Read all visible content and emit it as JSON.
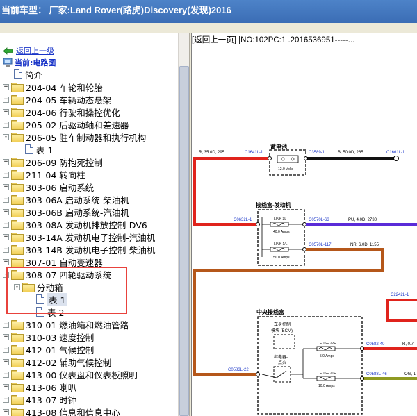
{
  "window": {
    "title": "当前车型： 厂家:Land Rover(路虎)Discovery(发现)2016"
  },
  "tree": {
    "back_label": "返回上一级",
    "current_label": "当前:电路图",
    "items": [
      {
        "label": "简介",
        "type": "doc",
        "indent": 1,
        "expand": ""
      },
      {
        "label": "204-04 车轮和轮胎",
        "type": "folder",
        "indent": 0,
        "expand": "+"
      },
      {
        "label": "204-05 车辆动态悬架",
        "type": "folder",
        "indent": 0,
        "expand": "+"
      },
      {
        "label": "204-06 行驶和操控优化",
        "type": "folder",
        "indent": 0,
        "expand": "+"
      },
      {
        "label": "205-02 后驱动轴和差速器",
        "type": "folder",
        "indent": 0,
        "expand": "+"
      },
      {
        "label": "206-05 驻车制动器和执行机构",
        "type": "folder",
        "indent": 0,
        "expand": "-"
      },
      {
        "label": "表 1",
        "type": "doc",
        "indent": 2,
        "expand": ""
      },
      {
        "label": "206-09 防抱死控制",
        "type": "folder",
        "indent": 0,
        "expand": "+"
      },
      {
        "label": "211-04 转向柱",
        "type": "folder",
        "indent": 0,
        "expand": "+"
      },
      {
        "label": "303-06 启动系统",
        "type": "folder",
        "indent": 0,
        "expand": "+"
      },
      {
        "label": "303-06A 启动系统-柴油机",
        "type": "folder",
        "indent": 0,
        "expand": "+"
      },
      {
        "label": "303-06B 启动系统-汽油机",
        "type": "folder",
        "indent": 0,
        "expand": "+"
      },
      {
        "label": "303-08A 发动机排放控制-DV6",
        "type": "folder",
        "indent": 0,
        "expand": "+"
      },
      {
        "label": "303-14A 发动机电子控制-汽油机",
        "type": "folder",
        "indent": 0,
        "expand": "+"
      },
      {
        "label": "303-14B 发动机电子控制-柴油机",
        "type": "folder",
        "indent": 0,
        "expand": "+"
      },
      {
        "label": "307-01 自动变速器",
        "type": "folder",
        "indent": 0,
        "expand": "+"
      },
      {
        "label": "308-07 四轮驱动系统",
        "type": "folder",
        "indent": 0,
        "expand": "-"
      },
      {
        "label": "分动箱",
        "type": "folder",
        "indent": 1,
        "expand": "-"
      },
      {
        "label": "表 1",
        "type": "doc",
        "indent": 3,
        "expand": "",
        "selected": true
      },
      {
        "label": "表 2",
        "type": "doc",
        "indent": 3,
        "expand": ""
      },
      {
        "label": "310-01 燃油箱和燃油管路",
        "type": "folder",
        "indent": 0,
        "expand": "+"
      },
      {
        "label": "310-03 速度控制",
        "type": "folder",
        "indent": 0,
        "expand": "+"
      },
      {
        "label": "412-01 气候控制",
        "type": "folder",
        "indent": 0,
        "expand": "+"
      },
      {
        "label": "412-02 辅助气候控制",
        "type": "folder",
        "indent": 0,
        "expand": "+"
      },
      {
        "label": "413-00 仪表盘和仪表板照明",
        "type": "folder",
        "indent": 0,
        "expand": "+"
      },
      {
        "label": "413-06 喇叭",
        "type": "folder",
        "indent": 0,
        "expand": "+"
      },
      {
        "label": "413-07 时钟",
        "type": "folder",
        "indent": 0,
        "expand": "+"
      },
      {
        "label": "413-08 信息和信息中心",
        "type": "folder",
        "indent": 0,
        "expand": "+"
      }
    ]
  },
  "content": {
    "nav_text": "[返回上一页] |NO:102PC:1 .2016536951-----...",
    "diagram": {
      "battery_title": "蓄电池",
      "battery_rating": "12.0 Volts",
      "wire_left_top": "R, 35.0D, 295",
      "conn_c1641l1a": "C1641L-1",
      "conn_c3589": "C3589-1",
      "wire_black": "B, 50.0D, 265",
      "conn_c1661l1": "C1661L-1",
      "fusebox_title": "接线盒-发动机",
      "conn_c0632l1": "C0632L-1",
      "link_3l": "LINK 3L",
      "amps_40": "40.0 Amps",
      "conn_c0570l63": "C0570L-63",
      "wire_pu": "PU, 4.0D, 2730",
      "link_1l": "LINK 1/L",
      "amps_50": "50.0 Amps",
      "conn_c0570l117": "C0570L-117",
      "wire_nr": "NR, 6.0D, 1155",
      "conn_c2242l1": "C2242L-1",
      "central_title": "中央接线盒",
      "bcm_line1": "车身控制",
      "bcm_line2": "模块 (BCM)",
      "relay_line1": "继电器-",
      "relay_line2": "点火",
      "fuse_22": "FUSE 22F",
      "amps_5": "5.0 Amps",
      "conn_c0582l40": "C0582-40",
      "wire_r07": "R, 0.7",
      "fuse_21": "FUSE 21F",
      "amps_10": "10.0 Amps",
      "conn_c0583l22": "C0583L-22",
      "conn_c0588l46": "C0588L-46",
      "wire_og": "OG, 1"
    }
  },
  "colors": {
    "titlebar": "#3b6db5",
    "link_blue": "#1a35c8",
    "wire_red": "#e0231c",
    "wire_black": "#111111",
    "wire_purple": "#5a2bd8",
    "wire_brown": "#b5571a",
    "wire_olive": "#8f9a22",
    "highlight": "#e8423c"
  }
}
